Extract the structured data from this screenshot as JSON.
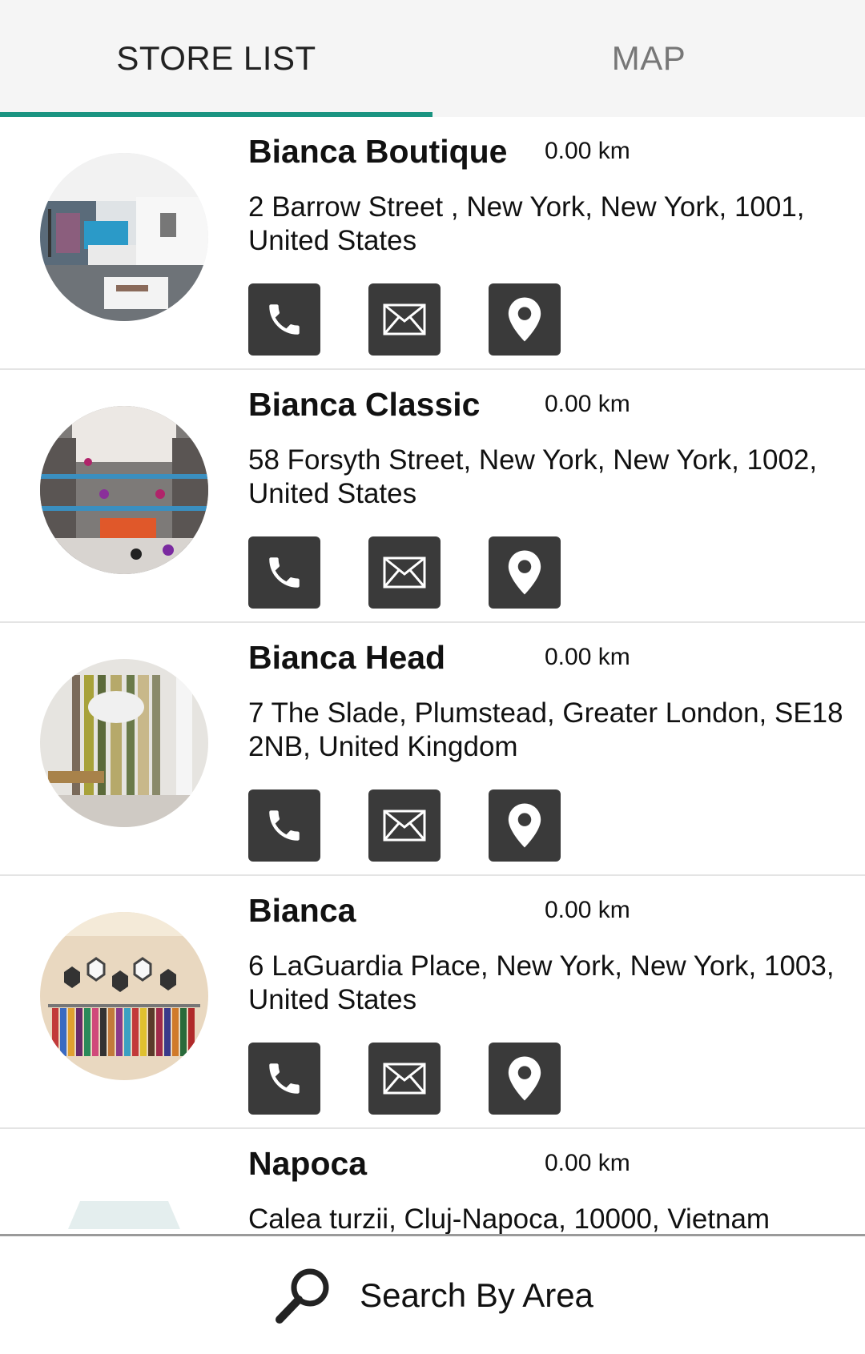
{
  "tabs": {
    "store_list": "STORE LIST",
    "map": "MAP",
    "active": "store_list"
  },
  "colors": {
    "accent": "#1a9481",
    "button_bg": "#3a3a3a"
  },
  "stores": [
    {
      "name": "Bianca Boutique",
      "distance": "0.00 km",
      "address": "2 Barrow Street , New York, New York, 1001, United States"
    },
    {
      "name": "Bianca Classic",
      "distance": "0.00 km",
      "address": "58 Forsyth Street, New York, New York, 1002, United States"
    },
    {
      "name": "Bianca Head",
      "distance": "0.00 km",
      "address": "7 The Slade, Plumstead, Greater London, SE18 2NB, United Kingdom"
    },
    {
      "name": "Bianca",
      "distance": "0.00 km",
      "address": "6 LaGuardia Place, New York, New York, 1003, United States"
    },
    {
      "name": "Napoca",
      "distance": "0.00 km",
      "address": "Calea turzii, Cluj-Napoca, 10000, Vietnam"
    }
  ],
  "icons": {
    "phone": "phone-icon",
    "email": "envelope-icon",
    "location": "map-pin-icon",
    "search": "search-icon"
  },
  "search": {
    "label": "Search By Area"
  }
}
